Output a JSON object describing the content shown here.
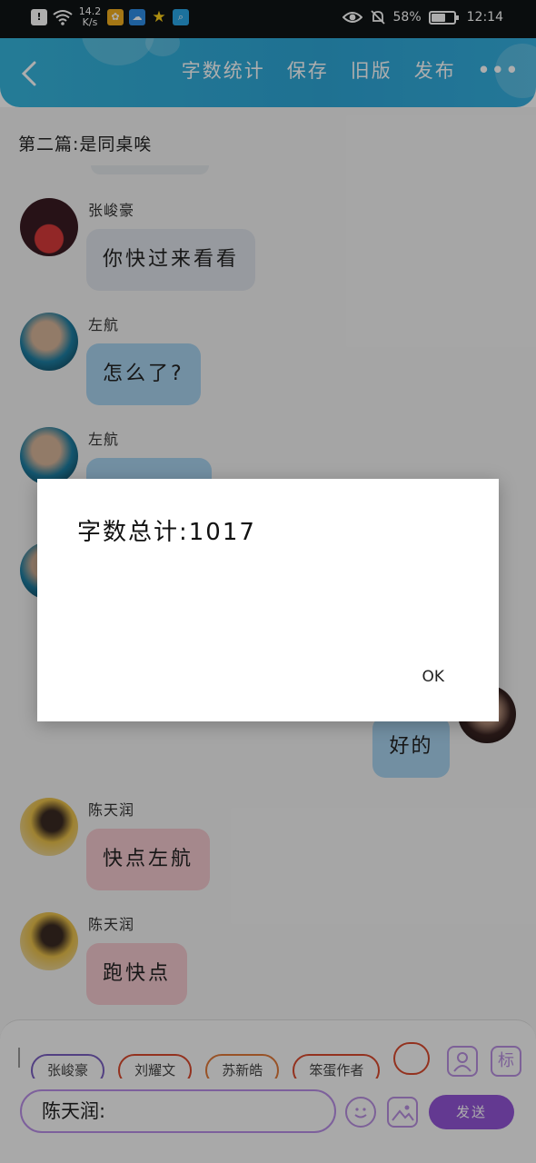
{
  "status_bar": {
    "net_speed": "14.2\nK/s",
    "battery": "58%",
    "time": "12:14"
  },
  "toolbar": {
    "word_count": "字数统计",
    "save": "保存",
    "old_version": "旧版",
    "publish": "发布"
  },
  "chapter_title": "第二篇:是同桌唉",
  "messages": [
    {
      "name": "张峻豪",
      "text": "你快过来看看"
    },
    {
      "name": "左航",
      "text": "怎么了?"
    },
    {
      "name": "左航",
      "text": ""
    },
    {
      "name": "",
      "text": "好的"
    },
    {
      "name": "陈天润",
      "text": "快点左航"
    },
    {
      "name": "陈天润",
      "text": "跑快点"
    }
  ],
  "characters": [
    {
      "label": "张峻豪",
      "color": "#7a5fc0"
    },
    {
      "label": "刘耀文",
      "color": "#d94a2e"
    },
    {
      "label": "苏新皓",
      "color": "#e07a3a"
    },
    {
      "label": "笨蛋作者",
      "color": "#d94a2e"
    },
    {
      "label": "",
      "color": "#d94a2e"
    }
  ],
  "input": {
    "value": "陈天润:"
  },
  "buttons": {
    "tag": "标",
    "send": "发送"
  },
  "dialog": {
    "message": "字数总计:1017",
    "ok": "OK"
  }
}
